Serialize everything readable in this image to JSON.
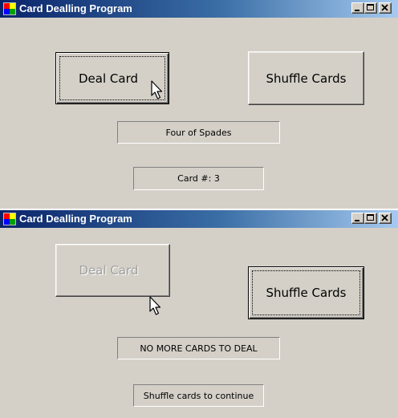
{
  "window_title": "Card Dealling Program",
  "screen1": {
    "deal_button": "Deal Card",
    "shuffle_button": "Shuffle Cards",
    "card_label": "Four of Spades",
    "count_label": "Card #: 3"
  },
  "screen2": {
    "deal_button": "Deal Card",
    "shuffle_button": "Shuffle Cards",
    "card_label": "NO MORE CARDS TO DEAL",
    "count_label": "Shuffle cards to continue"
  }
}
